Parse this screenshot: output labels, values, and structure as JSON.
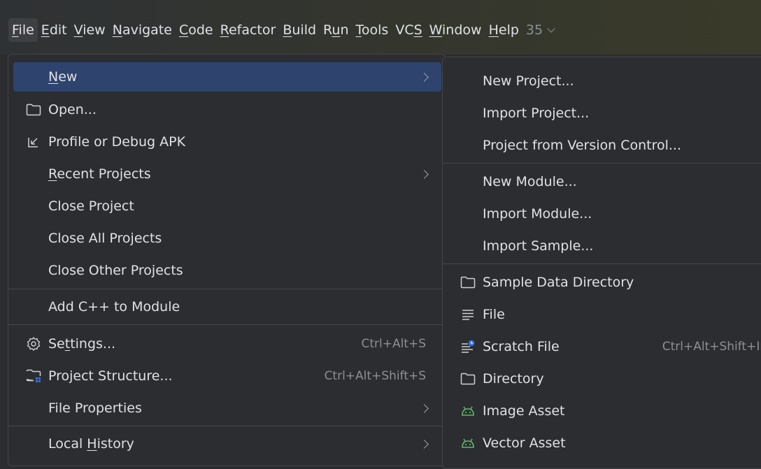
{
  "menubar": {
    "items": [
      {
        "label": "File",
        "active": true
      },
      {
        "label": "Edit"
      },
      {
        "label": "View"
      },
      {
        "label": "Navigate"
      },
      {
        "label": "Code"
      },
      {
        "label": "Refactor"
      },
      {
        "label": "Build"
      },
      {
        "label": "Run"
      },
      {
        "label": "Tools"
      },
      {
        "label": "VCS"
      },
      {
        "label": "Window"
      },
      {
        "label": "Help"
      }
    ],
    "overflow_label": "35"
  },
  "file_menu": {
    "items": [
      {
        "label": "New",
        "submenu": true,
        "selected": true
      },
      {
        "label": "Open...",
        "icon": "folder-icon"
      },
      {
        "label": "Profile or Debug APK",
        "icon": "import-arrow-icon"
      },
      {
        "label": "Recent Projects",
        "submenu": true
      },
      {
        "label": "Close Project"
      },
      {
        "label": "Close All Projects"
      },
      {
        "label": "Close Other Projects"
      },
      {
        "label": "Add C++ to Module"
      },
      {
        "label": "Settings...",
        "icon": "gear-icon",
        "shortcut": "Ctrl+Alt+S"
      },
      {
        "label": "Project Structure...",
        "icon": "project-structure-icon",
        "shortcut": "Ctrl+Alt+Shift+S"
      },
      {
        "label": "File Properties",
        "submenu": true
      },
      {
        "label": "Local History",
        "submenu": true
      }
    ]
  },
  "new_submenu": {
    "items": [
      {
        "label": "New Project..."
      },
      {
        "label": "Import Project..."
      },
      {
        "label": "Project from Version Control..."
      },
      {
        "label": "New Module..."
      },
      {
        "label": "Import Module..."
      },
      {
        "label": "Import Sample..."
      },
      {
        "label": "Sample Data Directory",
        "icon": "folder-icon"
      },
      {
        "label": "File",
        "icon": "file-lines-icon"
      },
      {
        "label": "Scratch File",
        "icon": "scratch-file-icon",
        "shortcut": "Ctrl+Alt+Shift+Ins"
      },
      {
        "label": "Directory",
        "icon": "folder-icon"
      },
      {
        "label": "Image Asset",
        "icon": "android-icon"
      },
      {
        "label": "Vector Asset",
        "icon": "android-icon"
      }
    ]
  },
  "colors": {
    "menu_bg": "#2b2d30",
    "selection": "#2e436e",
    "text": "#dfe1e5",
    "muted": "#8c8f94",
    "android_green": "#5fb865",
    "accent_blue": "#3574f0"
  }
}
